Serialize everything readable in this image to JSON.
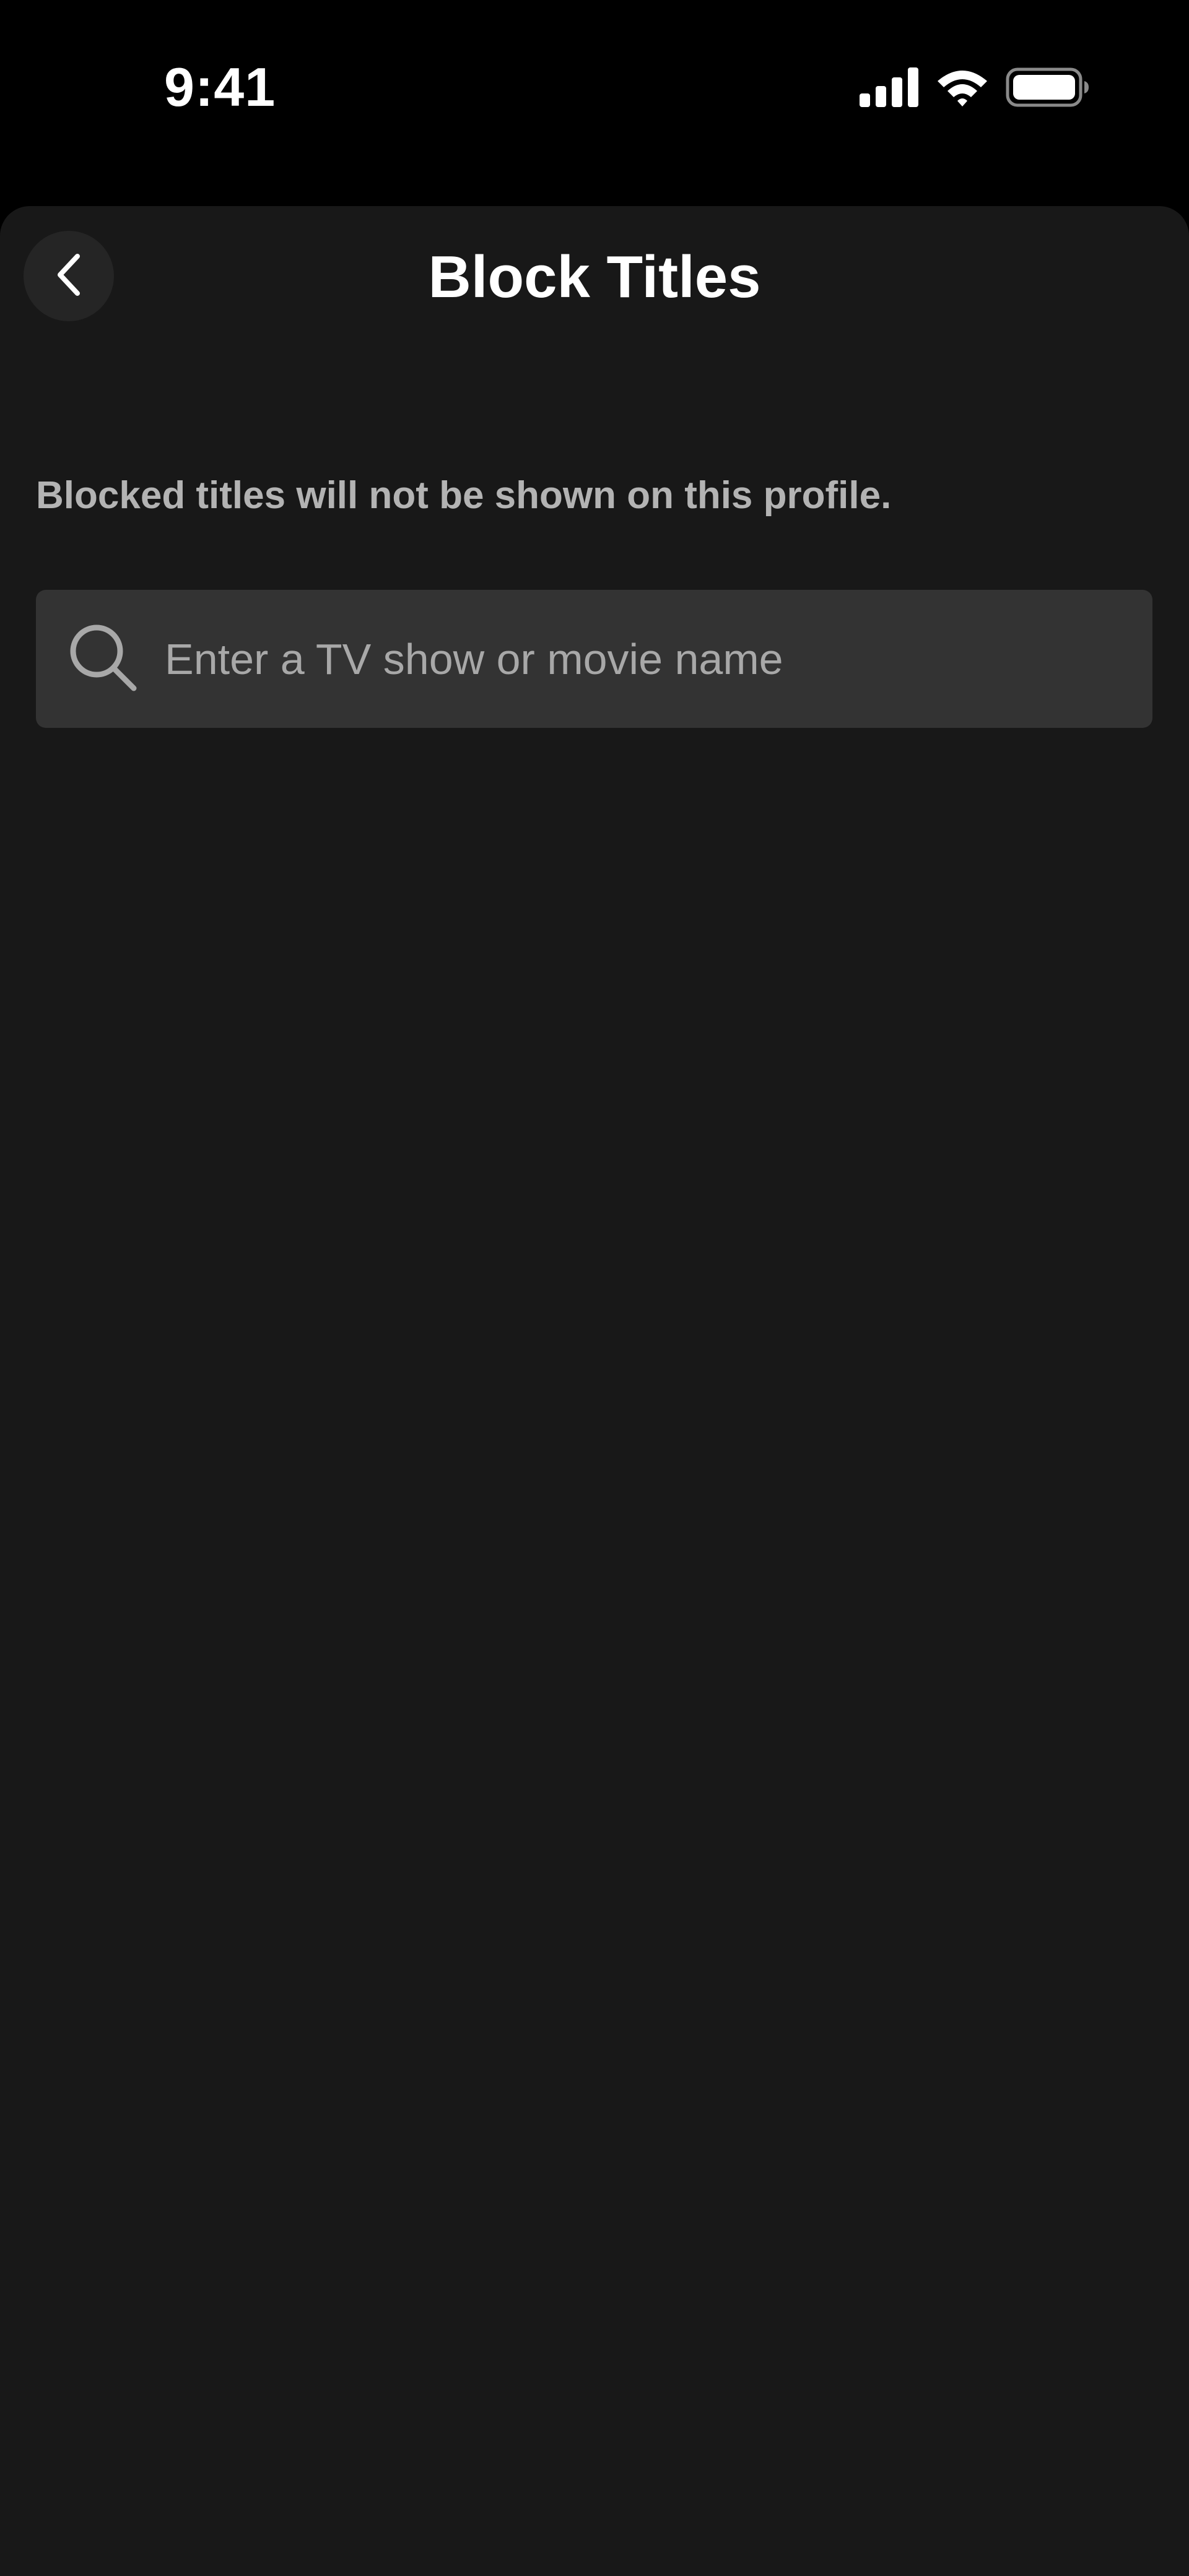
{
  "status_bar": {
    "time": "9:41",
    "icons": [
      "cellular-signal-icon",
      "wifi-icon",
      "battery-icon"
    ]
  },
  "header": {
    "back_icon": "chevron-left-icon",
    "title": "Block Titles"
  },
  "main": {
    "description": "Blocked titles will not be shown on this profile.",
    "search": {
      "icon": "search-icon",
      "value": "",
      "placeholder": "Enter a TV show or movie name"
    }
  },
  "colors": {
    "background": "#181818",
    "status_bar_background": "#000000",
    "search_background": "#333333",
    "text_primary": "#ffffff",
    "text_secondary": "#b3b3b3"
  }
}
